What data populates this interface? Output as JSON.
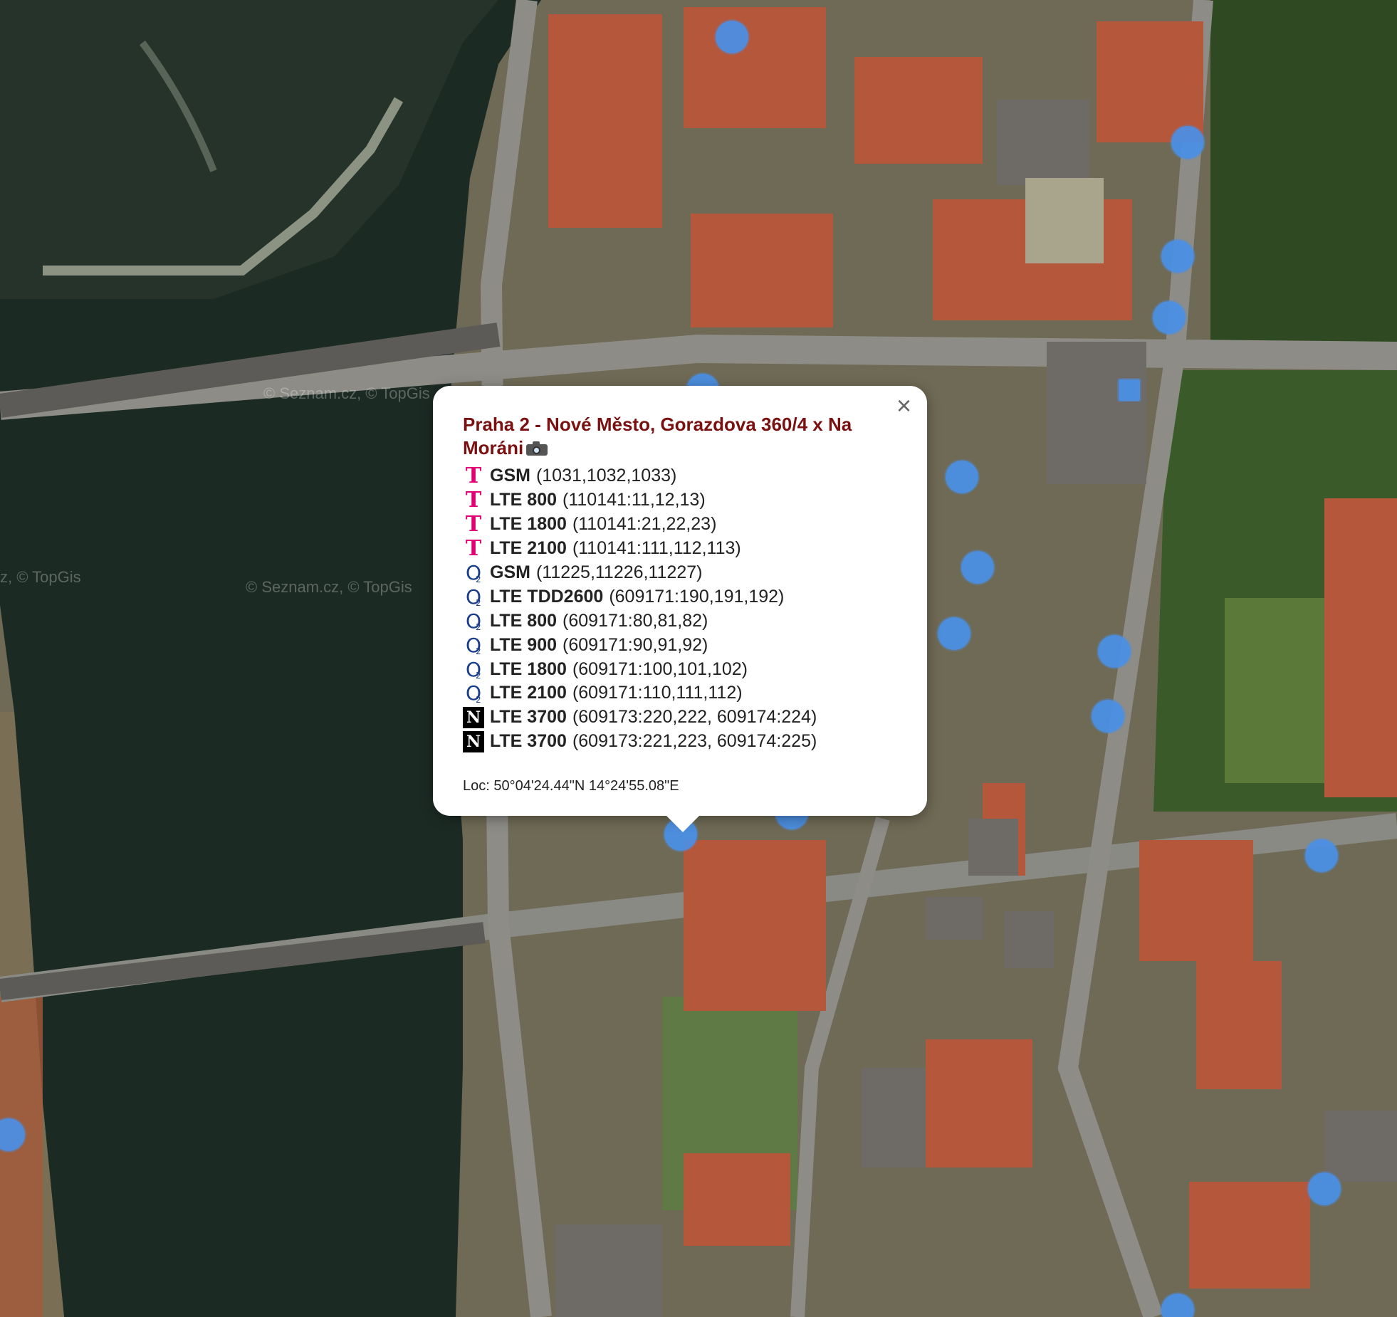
{
  "map": {
    "watermarks": [
      "© Seznam.cz, © TopGis",
      "© Seznam.cz, © TopGis",
      "z, © TopGis"
    ],
    "markers": [
      {
        "id": "m1"
      },
      {
        "id": "m2"
      },
      {
        "id": "m3"
      },
      {
        "id": "m4"
      },
      {
        "id": "m5"
      },
      {
        "id": "m6"
      },
      {
        "id": "m7"
      },
      {
        "id": "m8"
      },
      {
        "id": "m9"
      },
      {
        "id": "m10"
      },
      {
        "id": "m11"
      },
      {
        "id": "m12"
      },
      {
        "id": "m13"
      },
      {
        "id": "m14"
      },
      {
        "id": "m15"
      },
      {
        "id": "m16"
      },
      {
        "id": "m17"
      }
    ]
  },
  "popup": {
    "close_label": "×",
    "title": "Praha 2 - Nové Město, Gorazdova 360/4 x Na Moráni",
    "camera_icon": "camera-icon",
    "rows": [
      {
        "operator": "T",
        "icon": "t-mobile-icon",
        "tech": "GSM",
        "ids": "(1031,1032,1033)"
      },
      {
        "operator": "T",
        "icon": "t-mobile-icon",
        "tech": "LTE 800",
        "ids": "(110141:11,12,13)"
      },
      {
        "operator": "T",
        "icon": "t-mobile-icon",
        "tech": "LTE 1800",
        "ids": "(110141:21,22,23)"
      },
      {
        "operator": "T",
        "icon": "t-mobile-icon",
        "tech": "LTE 2100",
        "ids": "(110141:111,112,113)"
      },
      {
        "operator": "O2",
        "icon": "o2-icon",
        "tech": "GSM",
        "ids": "(11225,11226,11227)"
      },
      {
        "operator": "O2",
        "icon": "o2-icon",
        "tech": "LTE TDD2600",
        "ids": "(609171:190,191,192)"
      },
      {
        "operator": "O2",
        "icon": "o2-icon",
        "tech": "LTE 800",
        "ids": "(609171:80,81,82)"
      },
      {
        "operator": "O2",
        "icon": "o2-icon",
        "tech": "LTE 900",
        "ids": "(609171:90,91,92)"
      },
      {
        "operator": "O2",
        "icon": "o2-icon",
        "tech": "LTE 1800",
        "ids": "(609171:100,101,102)"
      },
      {
        "operator": "O2",
        "icon": "o2-icon",
        "tech": "LTE 2100",
        "ids": "(609171:110,111,112)"
      },
      {
        "operator": "N",
        "icon": "nordic-telecom-icon",
        "tech": "LTE 3700",
        "ids": "(609173:220,222, 609174:224)"
      },
      {
        "operator": "N",
        "icon": "nordic-telecom-icon",
        "tech": "LTE 3700",
        "ids": "(609173:221,223, 609174:225)"
      }
    ],
    "location": "Loc: 50°04'24.44\"N 14°24'55.08\"E"
  },
  "colors": {
    "marker": "#4a90e8",
    "title": "#7a1010",
    "t_mobile": "#e20074",
    "o2": "#1a3e8c",
    "river": "#1c2a24"
  }
}
